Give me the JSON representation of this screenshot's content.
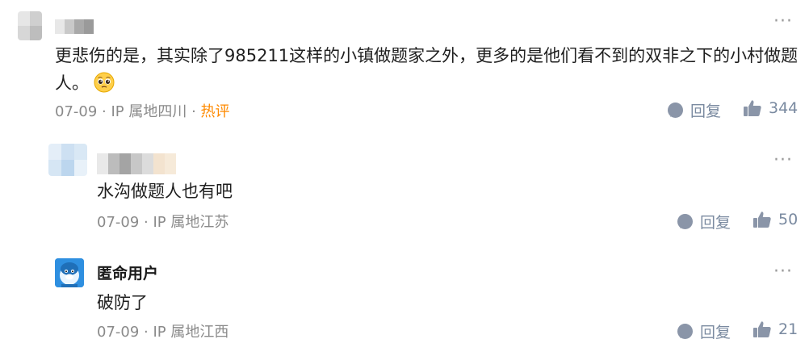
{
  "comments": [
    {
      "text": "更悲伤的是，其实除了985211这样的小镇做题家之外，更多的是他们看不到的双非之下的小村做题人。",
      "emoji": "pleading-face-emoji",
      "meta_prefix": "07-09 · IP 属地四川 · ",
      "hot_label": "热评",
      "reply_label": "回复",
      "like_count": "344",
      "more": "···"
    }
  ],
  "replies": [
    {
      "text": "水沟做题人也有吧",
      "meta": "07-09 · IP 属地江苏",
      "reply_label": "回复",
      "like_count": "50",
      "more": "···"
    },
    {
      "username": "匿命用户",
      "text": "破防了",
      "meta": "07-09 · IP 属地江西",
      "reply_label": "回复",
      "like_count": "21",
      "more": "···"
    }
  ],
  "colors": {
    "meta": "#8a8a8a",
    "hot": "#ff8a00",
    "action": "#7a8aa0"
  }
}
